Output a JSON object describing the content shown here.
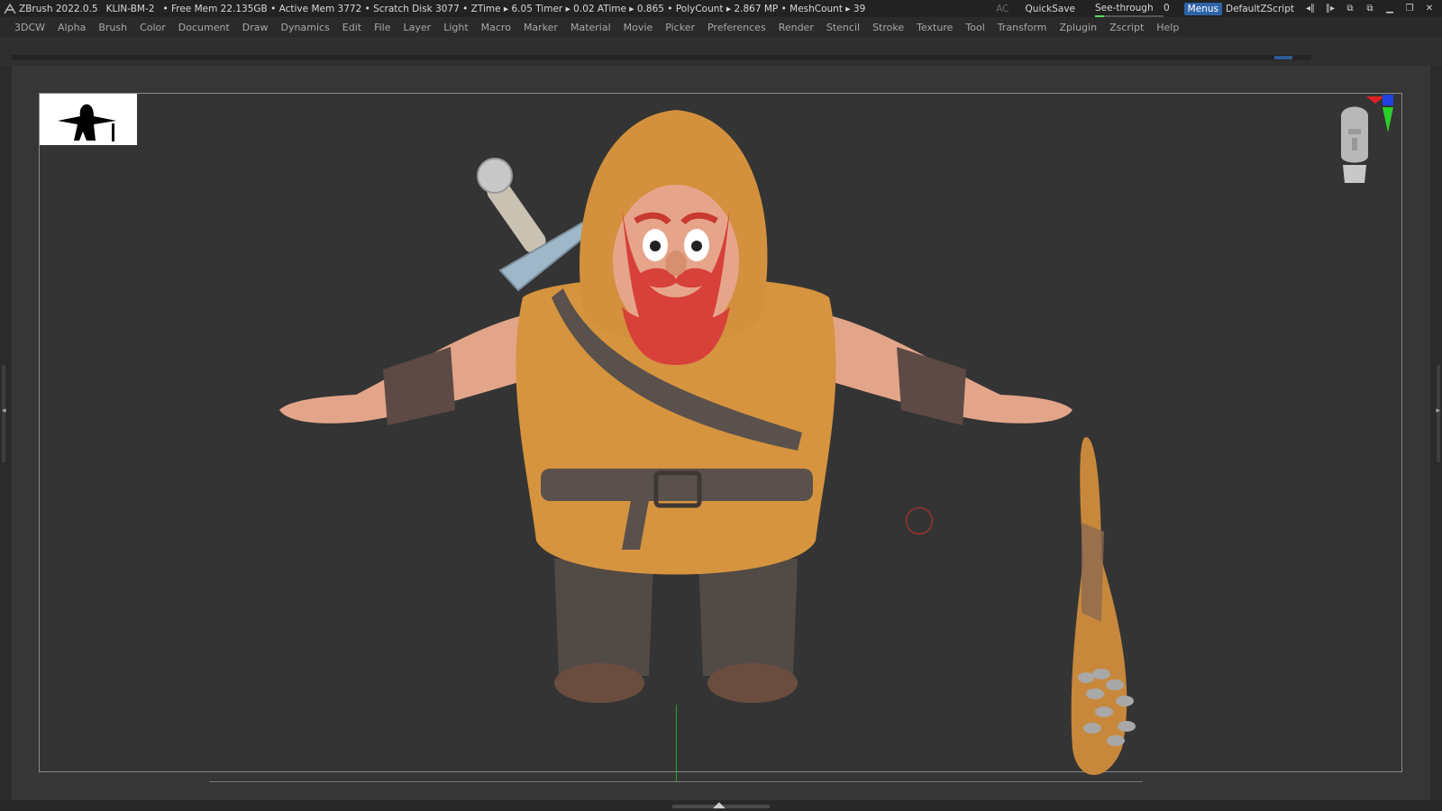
{
  "titlebar": {
    "app": "ZBrush 2022.0.5",
    "file": "KLIN-BM-2",
    "stats": "• Free Mem 22.135GB • Active Mem 3772 • Scratch Disk 3077 • ZTime ▸ 6.05 Timer ▸ 0.02 ATime ▸ 0.865 • PolyCount ▸ 2.867 MP • MeshCount ▸ 39",
    "ac": "AC",
    "quicksave": "QuickSave",
    "see_through_label": "See-through",
    "see_through_value": "0",
    "see_through_level": 0,
    "menus": "Menus",
    "script": "DefaultZScript"
  },
  "menubar": {
    "items": [
      "3DCW",
      "Alpha",
      "Brush",
      "Color",
      "Document",
      "Draw",
      "Dynamics",
      "Edit",
      "File",
      "Layer",
      "Light",
      "Macro",
      "Marker",
      "Material",
      "Movie",
      "Picker",
      "Preferences",
      "Render",
      "Stencil",
      "Stroke",
      "Texture",
      "Tool",
      "Transform",
      "Zplugin",
      "Zscript",
      "Help"
    ]
  },
  "icons": {
    "app_logo": "zbrush-logo-icon",
    "minimize": "minimize-icon",
    "restore": "restore-icon",
    "close": "close-icon"
  },
  "colors": {
    "menus_active": "#2f63a8",
    "see_through_indicator": "#5fd35f",
    "cloth": "#d6943f",
    "skin": "#e6a58a",
    "beard": "#d8403a",
    "leather": "#5b4a44",
    "pants": "#514a45",
    "axis_line": "#2aa02a"
  }
}
